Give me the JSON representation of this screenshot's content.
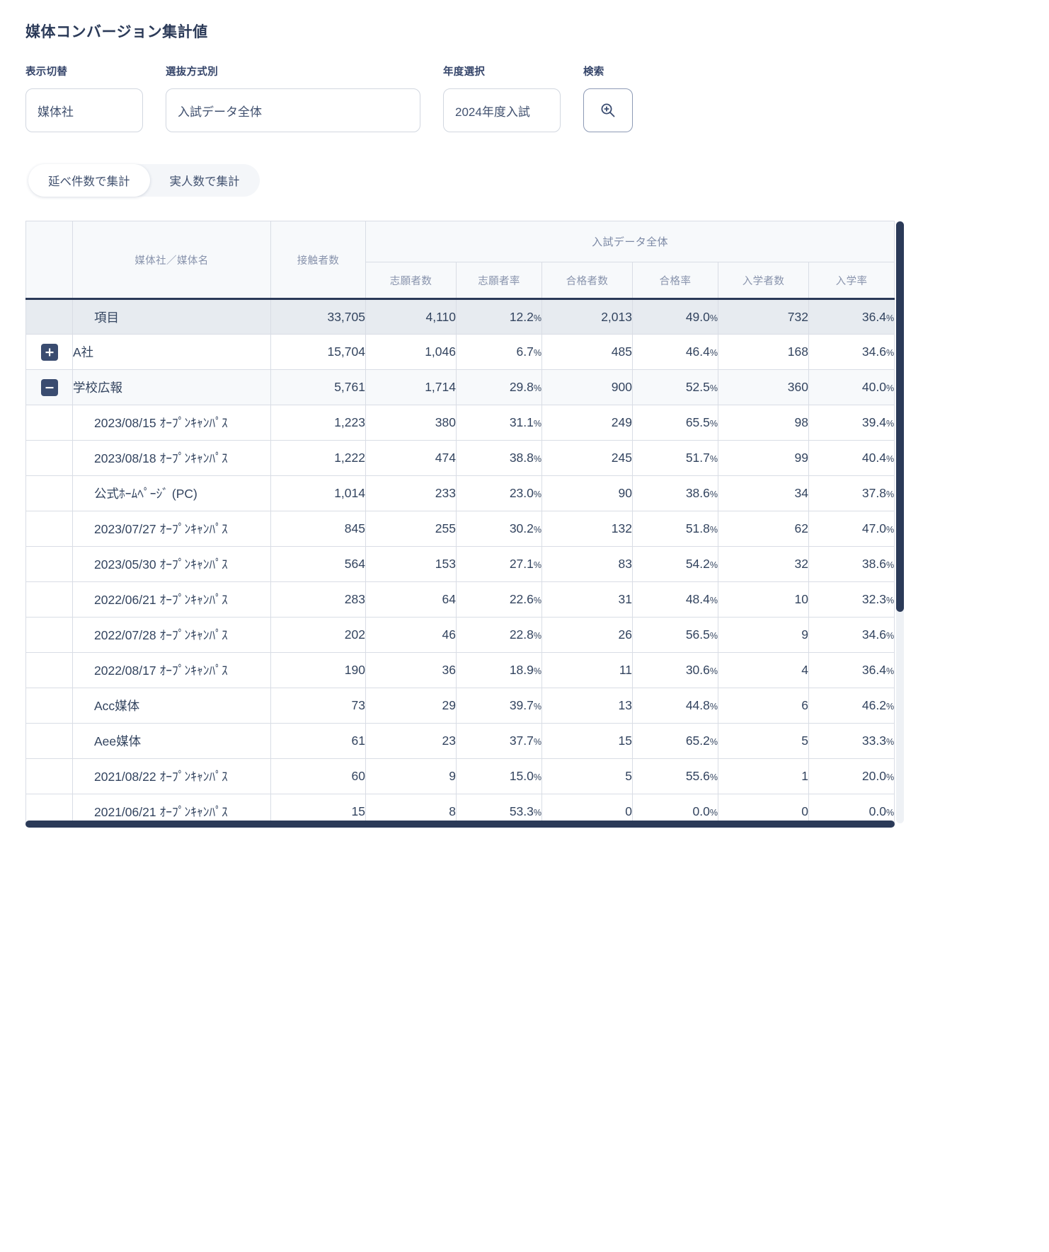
{
  "page": {
    "title": "媒体コンバージョン集計値"
  },
  "filters": [
    {
      "label": "表示切替",
      "value": "媒体社",
      "name": "display-switch"
    },
    {
      "label": "選抜方式別",
      "value": "入試データ全体",
      "name": "selection-method"
    },
    {
      "label": "年度選択",
      "value": "2024年度入試",
      "name": "year-select"
    }
  ],
  "search": {
    "label": "検索",
    "icon": "search-zoom-in-icon"
  },
  "tabs": [
    {
      "label": "延べ件数で集計",
      "active": true
    },
    {
      "label": "実人数で集計",
      "active": false
    }
  ],
  "table": {
    "headers": {
      "expand_col": "",
      "name": "媒体社／媒体名",
      "contacts": "接触者数",
      "group_title": "入試データ全体",
      "sub": [
        "志願者数",
        "志願者率",
        "合格者数",
        "合格率",
        "入学者数",
        "入学率"
      ]
    },
    "rows": [
      {
        "type": "total",
        "toggle": "",
        "name": "項目",
        "contacts": "33,705",
        "values": [
          "4,110",
          "12.2",
          "2,013",
          "49.0",
          "732",
          "36.4"
        ]
      },
      {
        "type": "group",
        "toggle": "plus",
        "name": "A社",
        "contacts": "15,704",
        "values": [
          "1,046",
          "6.7",
          "485",
          "46.4",
          "168",
          "34.6"
        ]
      },
      {
        "type": "sub",
        "toggle": "minus",
        "name": "学校広報",
        "contacts": "5,761",
        "values": [
          "1,714",
          "29.8",
          "900",
          "52.5",
          "360",
          "40.0"
        ]
      },
      {
        "type": "child",
        "toggle": "",
        "name": "2023/08/15 ｵｰﾌﾟﾝｷｬﾝﾊﾟｽ",
        "contacts": "1,223",
        "values": [
          "380",
          "31.1",
          "249",
          "65.5",
          "98",
          "39.4"
        ]
      },
      {
        "type": "child",
        "toggle": "",
        "name": "2023/08/18 ｵｰﾌﾟﾝｷｬﾝﾊﾟｽ",
        "contacts": "1,222",
        "values": [
          "474",
          "38.8",
          "245",
          "51.7",
          "99",
          "40.4"
        ]
      },
      {
        "type": "child",
        "toggle": "",
        "name": "公式ﾎｰﾑﾍﾟｰｼﾞ (PC)",
        "contacts": "1,014",
        "values": [
          "233",
          "23.0",
          "90",
          "38.6",
          "34",
          "37.8"
        ]
      },
      {
        "type": "child",
        "toggle": "",
        "name": "2023/07/27 ｵｰﾌﾟﾝｷｬﾝﾊﾟｽ",
        "contacts": "845",
        "values": [
          "255",
          "30.2",
          "132",
          "51.8",
          "62",
          "47.0"
        ]
      },
      {
        "type": "child",
        "toggle": "",
        "name": "2023/05/30 ｵｰﾌﾟﾝｷｬﾝﾊﾟｽ",
        "contacts": "564",
        "values": [
          "153",
          "27.1",
          "83",
          "54.2",
          "32",
          "38.6"
        ]
      },
      {
        "type": "child",
        "toggle": "",
        "name": "2022/06/21 ｵｰﾌﾟﾝｷｬﾝﾊﾟｽ",
        "contacts": "283",
        "values": [
          "64",
          "22.6",
          "31",
          "48.4",
          "10",
          "32.3"
        ]
      },
      {
        "type": "child",
        "toggle": "",
        "name": "2022/07/28 ｵｰﾌﾟﾝｷｬﾝﾊﾟｽ",
        "contacts": "202",
        "values": [
          "46",
          "22.8",
          "26",
          "56.5",
          "9",
          "34.6"
        ]
      },
      {
        "type": "child",
        "toggle": "",
        "name": "2022/08/17 ｵｰﾌﾟﾝｷｬﾝﾊﾟｽ",
        "contacts": "190",
        "values": [
          "36",
          "18.9",
          "11",
          "30.6",
          "4",
          "36.4"
        ]
      },
      {
        "type": "child",
        "toggle": "",
        "name": "Acc媒体",
        "contacts": "73",
        "values": [
          "29",
          "39.7",
          "13",
          "44.8",
          "6",
          "46.2"
        ]
      },
      {
        "type": "child",
        "toggle": "",
        "name": "Aee媒体",
        "contacts": "61",
        "values": [
          "23",
          "37.7",
          "15",
          "65.2",
          "5",
          "33.3"
        ]
      },
      {
        "type": "child",
        "toggle": "",
        "name": "2021/08/22 ｵｰﾌﾟﾝｷｬﾝﾊﾟｽ",
        "contacts": "60",
        "values": [
          "9",
          "15.0",
          "5",
          "55.6",
          "1",
          "20.0"
        ]
      },
      {
        "type": "child",
        "toggle": "",
        "name": "2021/06/21 ｵｰﾌﾟﾝｷｬﾝﾊﾟｽ",
        "contacts": "15",
        "values": [
          "8",
          "53.3",
          "0",
          "0.0",
          "0",
          "0.0"
        ]
      }
    ]
  },
  "colors": {
    "accent": "#2b3a58",
    "header_text": "#8893ac",
    "body_text": "#33445f",
    "total_row_bg": "#e7ebf0",
    "sub_row_bg": "#f7f9fb",
    "border": "#d9dde5"
  }
}
